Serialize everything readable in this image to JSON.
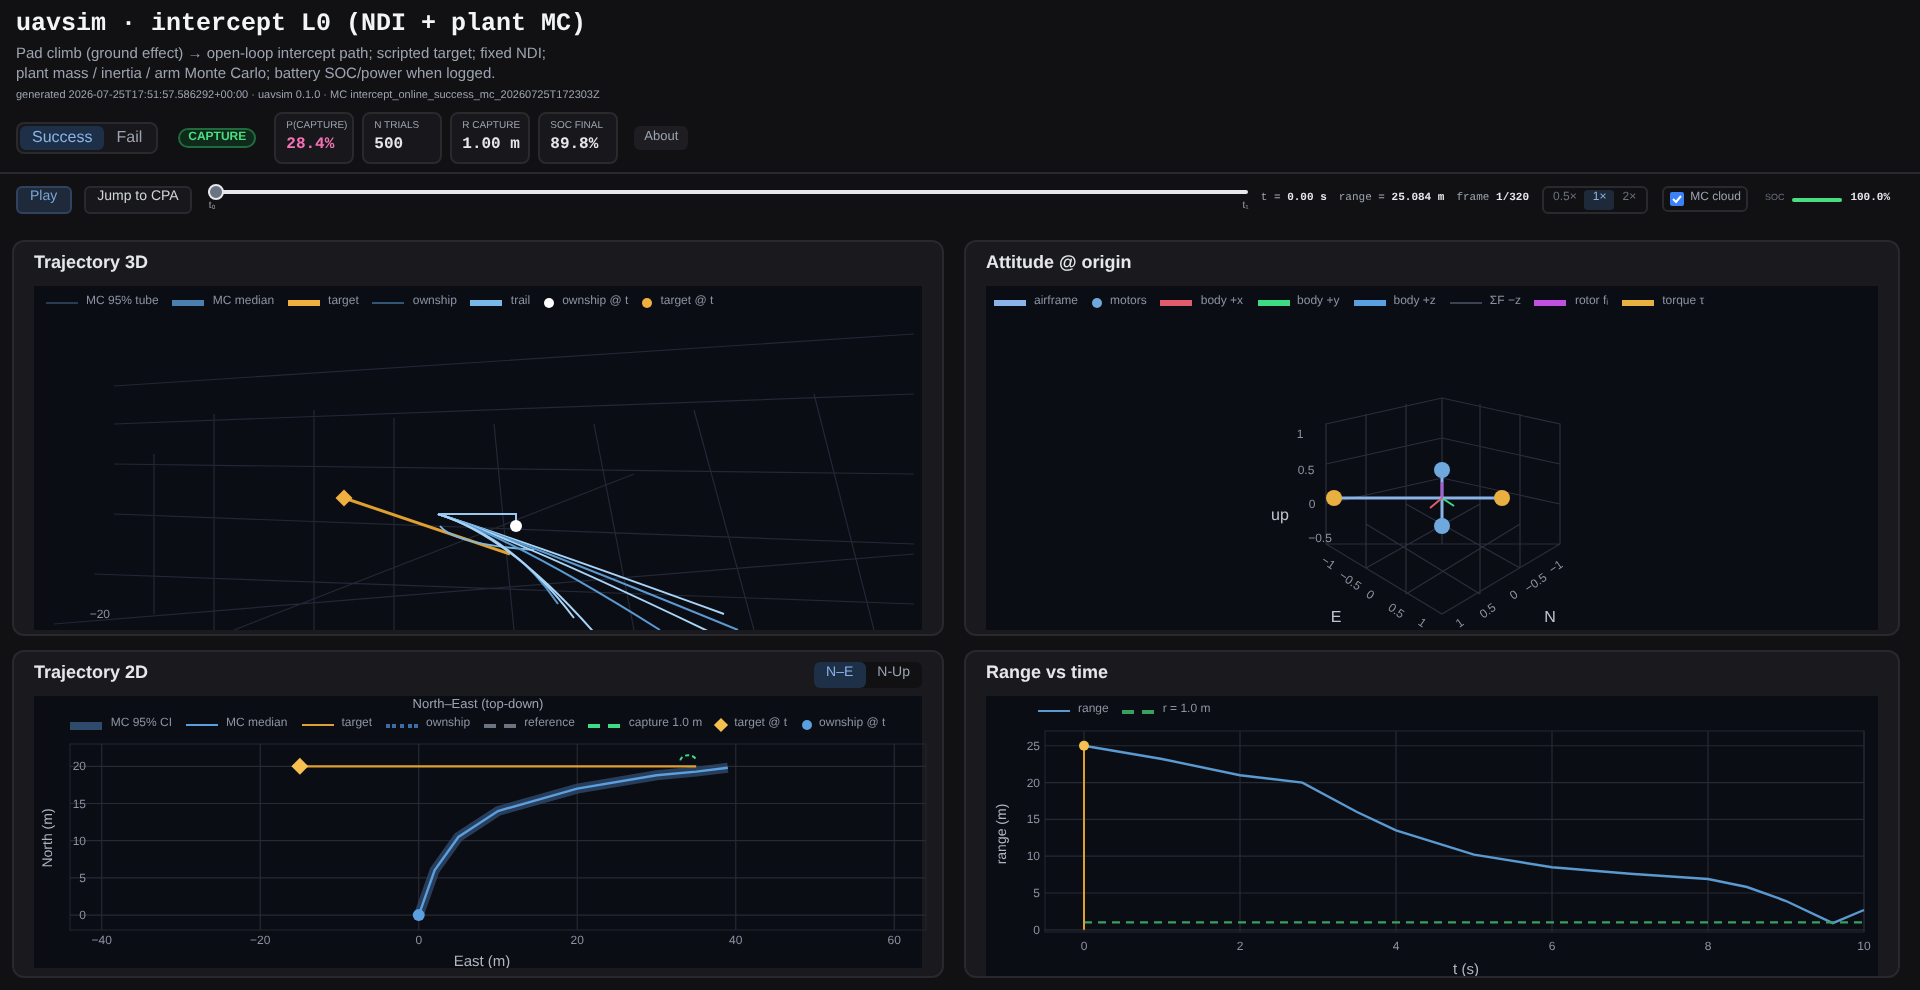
{
  "header": {
    "title": "uavsim · intercept L0 (NDI + plant MC)",
    "description_lines": [
      "Pad climb (ground effect) → open-loop intercept path; scripted target; fixed NDI;",
      "plant mass / inertia / arm Monte Carlo; battery SOC/power when logged."
    ],
    "meta": "generated 2026-07-25T17:51:57.586292+00:00 · uavsim 0.1.0 · MC intercept_online_success_mc_20260725T172303Z"
  },
  "outcome_tabs": [
    {
      "label": "Success",
      "selected": true
    },
    {
      "label": "Fail",
      "selected": false
    }
  ],
  "status_badge": "CAPTURE",
  "stats": [
    {
      "label": "P(CAPTURE)",
      "value": "28.4%",
      "kind": "alert"
    },
    {
      "label": "N TRIALS",
      "value": "500",
      "kind": "plain"
    },
    {
      "label": "R CAPTURE",
      "value": "1.00 m",
      "kind": "plain"
    },
    {
      "label": "SOC FINAL",
      "value": "89.8%",
      "kind": "plain"
    }
  ],
  "about_button": "About",
  "playback": {
    "play_button": "Play",
    "jump_button": "Jump to CPA",
    "level": 0,
    "start_mark": "t₀",
    "end_mark": "t₁",
    "readouts": [
      {
        "label": "t =",
        "value": "0.00 s"
      },
      {
        "label": "range =",
        "value": "25.084 m"
      },
      {
        "label": "frame",
        "value": "1/320"
      }
    ],
    "speeds": [
      {
        "label": "0.5×",
        "selected": false
      },
      {
        "label": "1×",
        "selected": true
      },
      {
        "label": "2×",
        "selected": false
      }
    ],
    "mc_cloud": {
      "label": "MC cloud",
      "checked": true
    },
    "soc": {
      "label": "SOC",
      "level": 1,
      "reading": "100.0%"
    }
  },
  "trajectory_3d": {
    "title": "Trajectory 3D",
    "legend": [
      {
        "label": "MC 95% tube",
        "kind": "line",
        "color": "#2b3b55"
      },
      {
        "label": "MC median",
        "kind": "thick",
        "color": "#4a7fb0"
      },
      {
        "label": "target",
        "kind": "thick",
        "color": "#f0b040"
      },
      {
        "label": "ownship",
        "kind": "line",
        "color": "#2f5577"
      },
      {
        "label": "trail",
        "kind": "thick",
        "color": "#7ab8e8"
      },
      {
        "label": "ownship @ t",
        "kind": "dot",
        "color": "#ffffff"
      },
      {
        "label": "target @ t",
        "kind": "dot",
        "color": "#f0b040"
      }
    ],
    "tick_labels": [
      "−20"
    ]
  },
  "attitude": {
    "title": "Attitude @ origin",
    "legend": [
      {
        "label": "airframe",
        "kind": "thick",
        "color": "#8ab4e8"
      },
      {
        "label": "motors",
        "kind": "dot",
        "color": "#6fa8dc"
      },
      {
        "label": "body +x",
        "kind": "thick",
        "color": "#e05c6c"
      },
      {
        "label": "body +y",
        "kind": "thick",
        "color": "#3ddc84"
      },
      {
        "label": "body +z",
        "kind": "thick",
        "color": "#5aa0e0"
      },
      {
        "label": "ΣF −z",
        "kind": "line",
        "color": "#3b4252"
      },
      {
        "label": "rotor fᵢ",
        "kind": "thick",
        "color": "#c050e0"
      },
      {
        "label": "torque τ",
        "kind": "thick",
        "color": "#e8b040"
      }
    ],
    "axes": [
      {
        "title": "up",
        "ticks": [
          "1",
          "0.5",
          "0",
          "−0.5"
        ]
      },
      {
        "title": "E",
        "ticks": [
          "−1",
          "−0.5",
          "0",
          "0.5",
          "1"
        ]
      },
      {
        "title": "N",
        "ticks": [
          "−1",
          "−0.5",
          "0",
          "0.5",
          "1"
        ]
      }
    ]
  },
  "trajectory_2d": {
    "title": "Trajectory 2D",
    "views": [
      {
        "label": "N–E",
        "selected": true
      },
      {
        "label": "N-Up",
        "selected": false
      }
    ],
    "legend_before": [
      {
        "label": "MC 95% CI",
        "kind": "band",
        "color": "#2f4a6a"
      }
    ],
    "legend_after": [
      {
        "label": "ownship",
        "kind": "dotted",
        "color": "#3a6ea5"
      },
      {
        "label": "reference",
        "kind": "dash",
        "color": "#6b7280"
      },
      {
        "label": "capture 1.0 m",
        "kind": "dash",
        "color": "#3ddc84"
      },
      {
        "label": "target @ t",
        "kind": "diamond",
        "color": "#f5c050"
      },
      {
        "label": "ownship @ t",
        "kind": "dot",
        "color": "#5aa0e0"
      }
    ],
    "chart_data": {
      "type": "line",
      "title": "North–East (top-down)",
      "xlabel": "East (m)",
      "ylabel": "North (m)",
      "x": [
        -15,
        0,
        2,
        5,
        10,
        20,
        30,
        35,
        39
      ],
      "series": [
        {
          "name": "MC median",
          "color": "#5aa0e0",
          "line_style": "solid",
          "values": [
            null,
            0,
            6,
            10.5,
            14,
            17,
            18.8,
            19.3,
            19.8
          ]
        },
        {
          "name": "target",
          "color": "#e0a030",
          "line_style": "solid",
          "values": [
            20,
            20,
            20,
            20,
            20,
            20,
            20,
            20,
            null
          ]
        }
      ],
      "xlim": [
        -44,
        64
      ],
      "ylim": [
        -2,
        23
      ],
      "xticks": [
        {
          "value": -40,
          "label": "−40"
        },
        {
          "value": -20,
          "label": "−20"
        },
        0,
        20,
        40,
        60
      ],
      "yticks": [
        0,
        5,
        10,
        15,
        20
      ],
      "grid": true,
      "legend": "top"
    }
  },
  "range_time": {
    "title": "Range vs time",
    "chart_data": {
      "type": "line",
      "xlabel": "t (s)",
      "ylabel": "range (m)",
      "x": [
        0,
        1,
        2,
        2.8,
        3.5,
        4,
        5,
        6,
        7,
        8,
        8.5,
        9,
        9.6,
        10
      ],
      "series": [
        {
          "name": "range",
          "color": "#5a9ad0",
          "line_style": "solid",
          "values": [
            25,
            23.2,
            21,
            20,
            16,
            13.5,
            10.2,
            8.5,
            7.6,
            6.9,
            5.8,
            3.9,
            0.9,
            2.7
          ]
        },
        {
          "name": "r = 1.0 m",
          "color": "#3aa060",
          "line_style": "dashed",
          "values": [
            1,
            1,
            1,
            1,
            1,
            1,
            1,
            1,
            1,
            1,
            1,
            1,
            1,
            1
          ]
        }
      ],
      "xlim": [
        -0.5,
        10
      ],
      "ylim": [
        -0.3,
        27
      ],
      "xticks": [
        0,
        2,
        4,
        6,
        8,
        10
      ],
      "yticks": [
        0,
        5,
        10,
        15,
        20,
        25
      ],
      "grid": true,
      "legend": "top",
      "ref_lines": [
        {
          "axis": "x",
          "value": 0,
          "color": "#e0a030"
        }
      ]
    }
  }
}
